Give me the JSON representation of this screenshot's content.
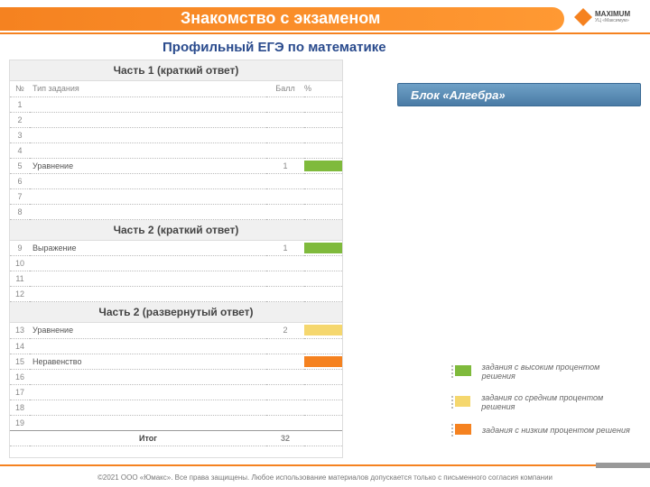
{
  "header": {
    "title": "Знакомство с экзаменом"
  },
  "logo": {
    "main": "MAXIMUM",
    "sub": "УЦ «Максимум»"
  },
  "subtitle": "Профильный ЕГЭ по математике",
  "cols": {
    "num": "№",
    "type": "Тип задания",
    "score": "Балл",
    "pct": "%"
  },
  "sections": {
    "s1": "Часть 1 (краткий ответ)",
    "s2": "Часть 2 (краткий ответ)",
    "s3": "Часть 2 (развернутый ответ)"
  },
  "rows": {
    "r1": {
      "n": "1",
      "t": "",
      "s": "",
      "c": ""
    },
    "r2": {
      "n": "2",
      "t": "",
      "s": "",
      "c": ""
    },
    "r3": {
      "n": "3",
      "t": "",
      "s": "",
      "c": ""
    },
    "r4": {
      "n": "4",
      "t": "",
      "s": "",
      "c": ""
    },
    "r5": {
      "n": "5",
      "t": "Уравнение",
      "s": "1",
      "c": "green"
    },
    "r6": {
      "n": "6",
      "t": "",
      "s": "",
      "c": ""
    },
    "r7": {
      "n": "7",
      "t": "",
      "s": "",
      "c": ""
    },
    "r8": {
      "n": "8",
      "t": "",
      "s": "",
      "c": ""
    },
    "r9": {
      "n": "9",
      "t": "Выражение",
      "s": "1",
      "c": "green"
    },
    "r10": {
      "n": "10",
      "t": "",
      "s": "",
      "c": ""
    },
    "r11": {
      "n": "11",
      "t": "",
      "s": "",
      "c": ""
    },
    "r12": {
      "n": "12",
      "t": "",
      "s": "",
      "c": ""
    },
    "r13": {
      "n": "13",
      "t": "Уравнение",
      "s": "2",
      "c": "yellow"
    },
    "r14": {
      "n": "14",
      "t": "",
      "s": "",
      "c": ""
    },
    "r15": {
      "n": "15",
      "t": "Неравенство",
      "s": "",
      "c": "orange"
    },
    "r16": {
      "n": "16",
      "t": "",
      "s": "",
      "c": ""
    },
    "r17": {
      "n": "17",
      "t": "",
      "s": "",
      "c": ""
    },
    "r18": {
      "n": "18",
      "t": "",
      "s": "",
      "c": ""
    },
    "r19": {
      "n": "19",
      "t": "",
      "s": "",
      "c": ""
    }
  },
  "totals": {
    "label": "Итог",
    "score": "32"
  },
  "block": {
    "title": "Блок «Алгебра»"
  },
  "legend": {
    "high": "задания с высоким процентом решения",
    "mid": "задания со средним процентом решения",
    "low": "задания с низким процентом решения"
  },
  "footer": "©2021 ООО «Юмакс». Все права защищены. Любое использование материалов допускается только с  письменного согласия компании",
  "chart_data": {
    "type": "table",
    "title": "Профильный ЕГЭ по математике — структура заданий (Блок «Алгебра»)",
    "columns": [
      "№",
      "Тип задания",
      "Балл",
      "Процент решения"
    ],
    "difficulty_scale": [
      "высокий",
      "средний",
      "низкий"
    ],
    "rows": [
      {
        "n": 5,
        "section": "Часть 1 (краткий ответ)",
        "type": "Уравнение",
        "score": 1,
        "difficulty": "высокий"
      },
      {
        "n": 9,
        "section": "Часть 2 (краткий ответ)",
        "type": "Выражение",
        "score": 1,
        "difficulty": "высокий"
      },
      {
        "n": 13,
        "section": "Часть 2 (развернутый ответ)",
        "type": "Уравнение",
        "score": 2,
        "difficulty": "средний"
      },
      {
        "n": 15,
        "section": "Часть 2 (развернутый ответ)",
        "type": "Неравенство",
        "score": null,
        "difficulty": "низкий"
      }
    ],
    "total_score": 32
  }
}
